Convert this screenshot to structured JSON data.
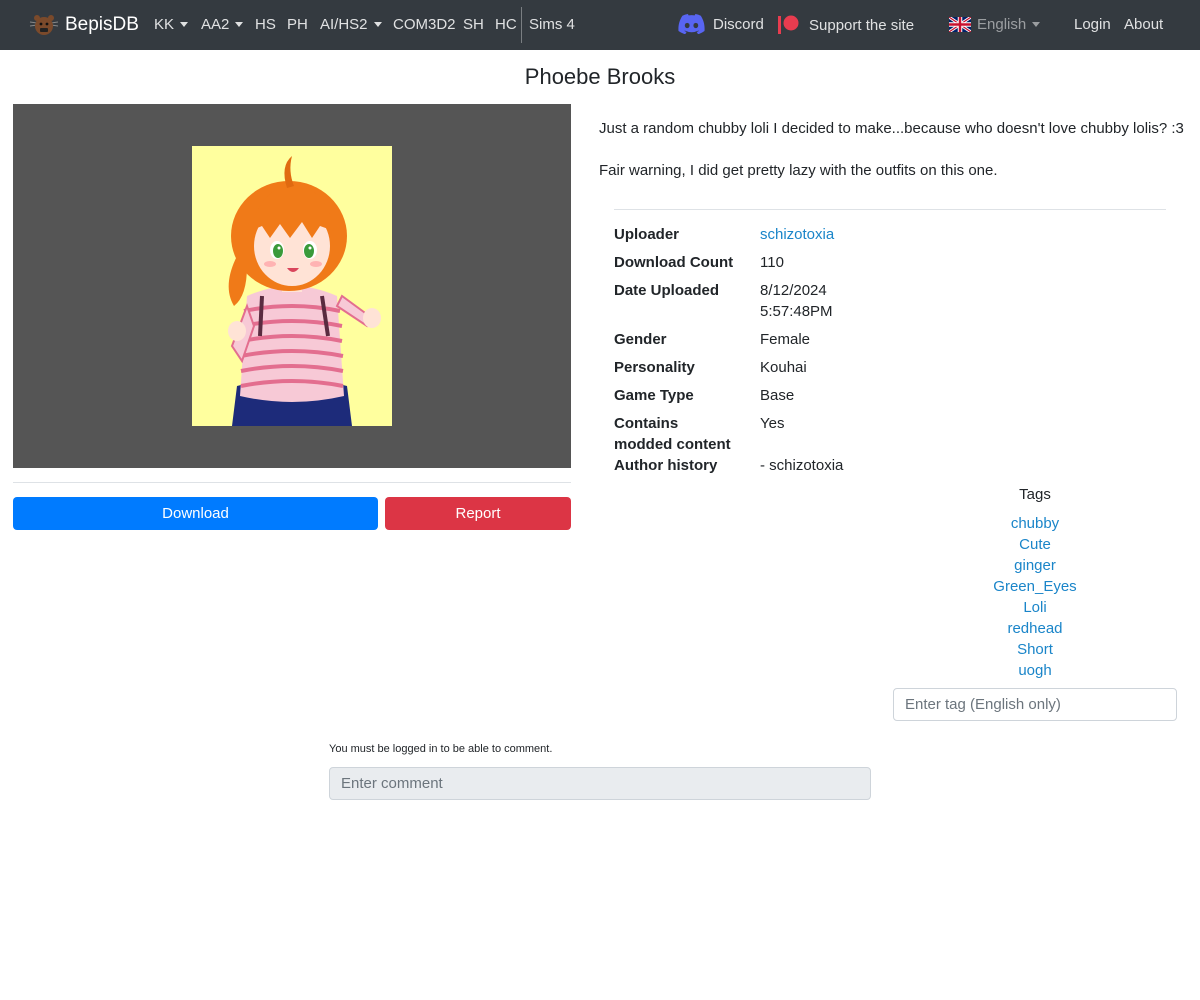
{
  "navbar": {
    "brand": "BepisDB",
    "items": [
      {
        "label": "KK",
        "dropdown": true
      },
      {
        "label": "AA2",
        "dropdown": true
      },
      {
        "label": "HS",
        "dropdown": false
      },
      {
        "label": "PH",
        "dropdown": false
      },
      {
        "label": "AI/HS2",
        "dropdown": true
      },
      {
        "label": "COM3D2",
        "dropdown": false
      },
      {
        "label": "SH",
        "dropdown": false
      },
      {
        "label": "HC",
        "dropdown": false
      },
      {
        "label": "Sims 4",
        "dropdown": false
      }
    ],
    "discord": "Discord",
    "support": "Support the site",
    "language": "English",
    "login": "Login",
    "about": "About"
  },
  "card": {
    "title": "Phoebe Brooks",
    "description": [
      "Just a random chubby loli I decided to make...because who doesn't love chubby lolis? :3",
      "Fair warning, I did get pretty lazy with the outfits on this one."
    ],
    "download_label": "Download",
    "report_label": "Report"
  },
  "info": {
    "uploader_label": "Uploader",
    "uploader": "schizotoxia",
    "download_count_label": "Download Count",
    "download_count": "110",
    "date_label": "Date Uploaded",
    "date": "8/12/2024",
    "time": "5:57:48PM",
    "gender_label": "Gender",
    "gender": "Female",
    "personality_label": "Personality",
    "personality": "Kouhai",
    "game_type_label": "Game Type",
    "game_type": "Base",
    "modded_label_1": "Contains",
    "modded_label_2": "modded content",
    "modded": "Yes",
    "author_history_label": "Author history",
    "author_history": "- schizotoxia"
  },
  "tags": {
    "heading": "Tags",
    "items": [
      "chubby",
      "Cute",
      "ginger",
      "Green_Eyes",
      "Loli",
      "redhead",
      "Short",
      "uogh"
    ],
    "input_placeholder": "Enter tag (English only)"
  },
  "comments": {
    "note": "You must be logged in to be able to comment.",
    "input_placeholder": "Enter comment"
  },
  "colors": {
    "navbar_bg": "#343a40",
    "primary": "#007bff",
    "danger": "#dc3545",
    "link": "#1a85c9",
    "preview_bg": "#555555",
    "image_bg": "#ffff9e"
  }
}
